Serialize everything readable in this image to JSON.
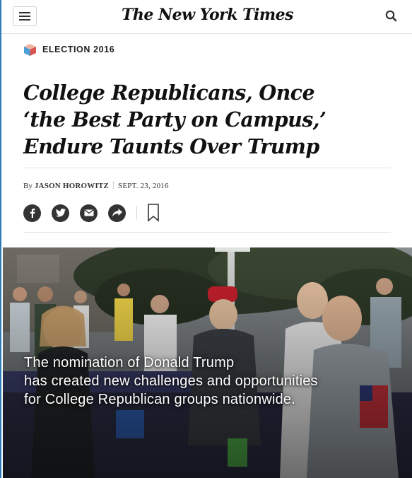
{
  "header": {
    "logo_text": "The New York Times",
    "menu_icon": "hamburger-menu-icon",
    "search_icon": "search-icon"
  },
  "section": {
    "label": "ELECTION 2016",
    "icon": "ballot-box-icon"
  },
  "article": {
    "headline_lines": [
      "College Republicans, Once",
      "‘the Best Party on Campus,’",
      "Endure Taunts Over Trump"
    ],
    "byline_prefix": "By",
    "author": "JASON HOROWITZ",
    "date": "SEPT. 23, 2016"
  },
  "share": {
    "items": [
      {
        "name": "facebook",
        "icon": "facebook-icon"
      },
      {
        "name": "twitter",
        "icon": "twitter-icon"
      },
      {
        "name": "email",
        "icon": "email-icon"
      },
      {
        "name": "share",
        "icon": "share-arrow-icon"
      }
    ],
    "bookmark_icon": "bookmark-icon"
  },
  "hero": {
    "caption_lines": [
      "The nomination of Donald Trump",
      "has created new challenges and opportunities",
      "for College Republican groups nationwide."
    ]
  },
  "colors": {
    "text": "#121212",
    "share_icon_bg": "#333333",
    "rule": "#e2e2e2",
    "frame_accent": "#2b7bb9"
  }
}
